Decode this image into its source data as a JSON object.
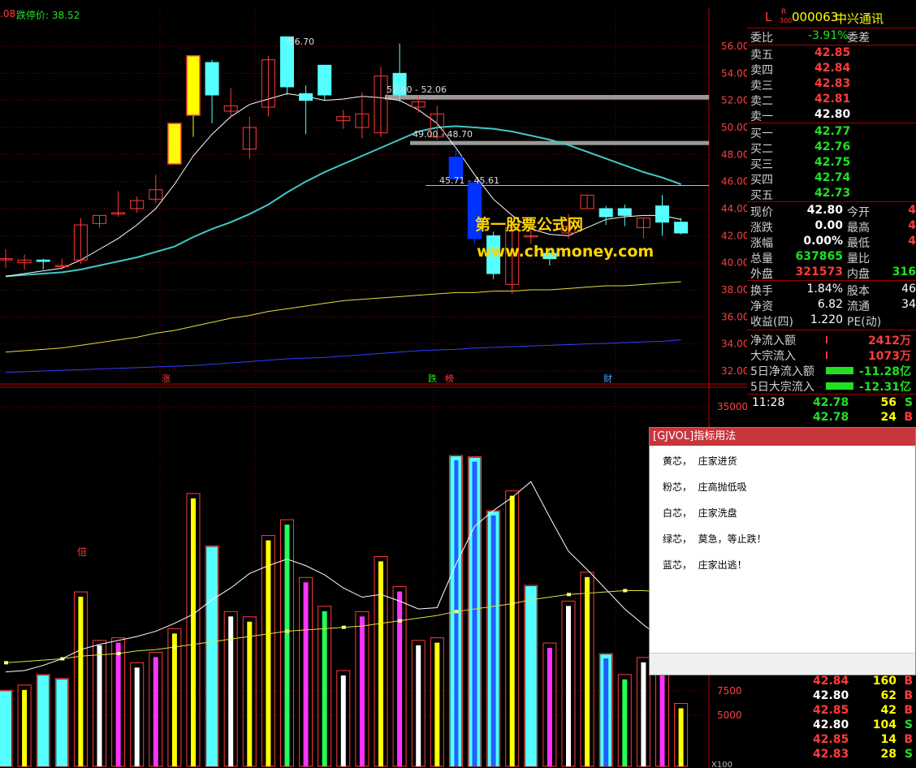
{
  "header": {
    "limit_down_label": "跌停价:",
    "limit_down_value": "38.52",
    "left_edge_value": ".08"
  },
  "stock": {
    "letter": "L",
    "badge_top": "R",
    "badge_bottom": "300",
    "code": "000063",
    "name": "中兴通讯"
  },
  "quote": {
    "webi_label": "委比",
    "webi_value": "-3.91%",
    "weicha_label": "委差",
    "asks": [
      {
        "label": "卖五",
        "price": "42.85"
      },
      {
        "label": "卖四",
        "price": "42.84"
      },
      {
        "label": "卖三",
        "price": "42.83"
      },
      {
        "label": "卖二",
        "price": "42.81"
      },
      {
        "label": "卖一",
        "price": "42.80"
      }
    ],
    "bids": [
      {
        "label": "买一",
        "price": "42.77"
      },
      {
        "label": "买二",
        "price": "42.76"
      },
      {
        "label": "买三",
        "price": "42.75"
      },
      {
        "label": "买四",
        "price": "42.74"
      },
      {
        "label": "买五",
        "price": "42.73"
      }
    ],
    "stats": [
      {
        "l1": "现价",
        "v1": "42.80",
        "l2": "今开",
        "v2": "4"
      },
      {
        "l1": "涨跌",
        "v1": "0.00",
        "l2": "最高",
        "v2": "4"
      },
      {
        "l1": "涨幅",
        "v1": "0.00%",
        "l2": "最低",
        "v2": "4"
      },
      {
        "l1": "总量",
        "v1": "637865",
        "l2": "量比",
        "v2": ""
      },
      {
        "l1": "外盘",
        "v1": "321573",
        "l2": "内盘",
        "v2": "316"
      }
    ],
    "stats2": [
      {
        "l1": "换手",
        "v1": "1.84%",
        "l2": "股本",
        "v2": "46"
      },
      {
        "l1": "净资",
        "v1": "6.82",
        "l2": "流通",
        "v2": "34"
      },
      {
        "l1": "收益(四)",
        "v1": "1.220",
        "l2": "PE(动)",
        "v2": ""
      }
    ],
    "flows": [
      {
        "label": "净流入额",
        "value": "2412万"
      },
      {
        "label": "大宗流入",
        "value": "1073万"
      },
      {
        "label": "5日净流入额",
        "value": "-11.28亿"
      },
      {
        "label": "5日大宗流入",
        "value": "-12.31亿"
      }
    ],
    "ticks_top": [
      {
        "time": "11:28",
        "price": "42.78",
        "vol": "56",
        "side": "S"
      },
      {
        "time": "",
        "price": "42.78",
        "vol": "24",
        "side": "B"
      }
    ],
    "ticks_bottom": [
      {
        "price": "42.84",
        "vol": "160",
        "side": "B"
      },
      {
        "price": "42.80",
        "vol": "62",
        "side": "B"
      },
      {
        "price": "42.85",
        "vol": "42",
        "side": "B"
      },
      {
        "price": "42.80",
        "vol": "104",
        "side": "S"
      },
      {
        "price": "42.85",
        "vol": "14",
        "side": "B"
      },
      {
        "price": "42.83",
        "vol": "28",
        "side": "S"
      }
    ]
  },
  "popup": {
    "title": "[GJVOL]指标用法",
    "lines": [
      "黄芯，  庄家进货",
      "粉芯，  庄高抛低吸",
      "白芯，  庄家洗盘",
      "绿芯，  莫急，等止跌！",
      "蓝芯，  庄家出逃！"
    ]
  },
  "watermark": {
    "line1": "第一股票公式网",
    "line2": "www.chnmoney.com"
  },
  "markers": {
    "rise": "涨",
    "fall": "跌",
    "list": "榜",
    "fin": "财",
    "bei": "倍"
  },
  "annotations": {
    "high": "56.70",
    "zone1": "52.40 - 52.06",
    "zone2": "49.00 - 48.70",
    "zone3": "45.71 - 45.61"
  },
  "vol_axis_unit": "X100",
  "colors": {
    "up": "#ff3b3b",
    "down_cyan": "#55ffff",
    "ma_cyan": "#40c8c8",
    "ma_yellow": "#e0e040",
    "ma_blue": "#3040ff",
    "grid_red": "#8b0000"
  },
  "chart_data": [
    {
      "type": "candlestick",
      "y_ticks": [
        "56.00",
        "54.00",
        "52.00",
        "50.00",
        "48.00",
        "46.00",
        "44.00",
        "42.00",
        "40.00",
        "38.00",
        "36.00",
        "34.00",
        "32.00"
      ],
      "ylim": [
        31.5,
        57.5
      ],
      "candles": [
        {
          "o": 40.3,
          "c": 40.3,
          "h": 41.0,
          "l": 39.6
        },
        {
          "o": 40.0,
          "c": 40.2,
          "h": 40.6,
          "l": 39.5
        },
        {
          "o": 40.2,
          "c": 40.1,
          "h": 40.3,
          "l": 39.5
        },
        {
          "o": 39.8,
          "c": 39.8,
          "h": 40.3,
          "l": 39.5
        },
        {
          "o": 40.2,
          "c": 42.8,
          "h": 43.3,
          "l": 39.9
        },
        {
          "o": 42.9,
          "c": 43.5,
          "h": 43.5,
          "l": 42.6
        },
        {
          "o": 43.6,
          "c": 43.7,
          "h": 45.3,
          "l": 43.4
        },
        {
          "o": 44.0,
          "c": 44.6,
          "h": 44.9,
          "l": 43.7
        },
        {
          "o": 44.7,
          "c": 45.4,
          "h": 46.5,
          "l": 44.4
        },
        {
          "o": 47.3,
          "c": 50.3,
          "h": 50.3,
          "l": 47.3
        },
        {
          "o": 50.9,
          "c": 55.3,
          "h": 55.3,
          "l": 49.3
        },
        {
          "o": 54.8,
          "c": 52.4,
          "h": 55.0,
          "l": 50.3
        },
        {
          "o": 51.2,
          "c": 51.6,
          "h": 52.9,
          "l": 50.7
        },
        {
          "o": 48.4,
          "c": 50.0,
          "h": 50.8,
          "l": 47.7
        },
        {
          "o": 51.5,
          "c": 55.0,
          "h": 55.3,
          "l": 50.8
        },
        {
          "o": 56.7,
          "c": 53.0,
          "h": 56.7,
          "l": 52.4
        },
        {
          "o": 52.5,
          "c": 52.0,
          "h": 53.1,
          "l": 49.5
        },
        {
          "o": 54.6,
          "c": 52.4,
          "h": 54.6,
          "l": 52.0
        },
        {
          "o": 50.5,
          "c": 50.8,
          "h": 51.3,
          "l": 49.9
        },
        {
          "o": 50.0,
          "c": 51.0,
          "h": 52.6,
          "l": 49.2
        },
        {
          "o": 49.6,
          "c": 53.8,
          "h": 54.5,
          "l": 49.3
        },
        {
          "o": 54.0,
          "c": 52.4,
          "h": 56.2,
          "l": 51.9
        },
        {
          "o": 51.5,
          "c": 51.9,
          "h": 52.4,
          "l": 51.1
        },
        {
          "o": 49.3,
          "c": 51.0,
          "h": 51.6,
          "l": 49.1
        },
        {
          "o": 47.8,
          "c": 46.2,
          "h": 48.4,
          "l": 46.2
        },
        {
          "o": 45.9,
          "c": 41.8,
          "h": 45.9,
          "l": 41.4
        },
        {
          "o": 42.0,
          "c": 39.2,
          "h": 42.3,
          "l": 38.8
        },
        {
          "o": 38.4,
          "c": 42.6,
          "h": 42.8,
          "l": 37.7
        },
        {
          "o": 42.0,
          "c": 42.0,
          "h": 42.4,
          "l": 41.4
        },
        {
          "o": 40.7,
          "c": 40.3,
          "h": 41.0,
          "l": 39.8
        },
        {
          "o": 42.2,
          "c": 42.7,
          "h": 43.6,
          "l": 41.8
        },
        {
          "o": 44.0,
          "c": 45.0,
          "h": 45.0,
          "l": 44.0
        },
        {
          "o": 44.0,
          "c": 43.4,
          "h": 44.2,
          "l": 42.8
        },
        {
          "o": 44.0,
          "c": 43.5,
          "h": 44.3,
          "l": 42.7
        },
        {
          "o": 42.6,
          "c": 43.3,
          "h": 43.3,
          "l": 41.8
        },
        {
          "o": 44.2,
          "c": 43.0,
          "h": 45.0,
          "l": 42.0
        },
        {
          "o": 43.0,
          "c": 42.2,
          "h": 43.3,
          "l": 42.1
        }
      ],
      "ma_white": [
        39.0,
        39.2,
        39.4,
        39.6,
        40.2,
        41.0,
        41.8,
        42.8,
        44.0,
        45.8,
        47.9,
        49.5,
        50.8,
        51.7,
        52.1,
        52.5,
        52.3,
        52.0,
        52.1,
        52.3,
        52.2,
        52.0,
        51.3,
        50.3,
        48.5,
        46.5,
        44.7,
        43.5,
        42.5,
        42.1,
        42.0,
        42.6,
        43.2,
        43.4,
        43.5,
        43.5,
        43.2
      ],
      "ma_cyan": [
        39.0,
        39.1,
        39.2,
        39.3,
        39.5,
        39.8,
        40.1,
        40.4,
        40.8,
        41.2,
        41.9,
        42.5,
        43.0,
        43.6,
        44.3,
        45.2,
        46.0,
        46.7,
        47.3,
        47.9,
        48.5,
        49.1,
        49.7,
        50.0,
        50.1,
        50.0,
        49.9,
        49.7,
        49.4,
        49.1,
        48.7,
        48.2,
        47.7,
        47.2,
        46.7,
        46.3,
        45.8
      ],
      "ma_yellow": [
        33.4,
        33.5,
        33.6,
        33.7,
        33.9,
        34.1,
        34.3,
        34.5,
        34.8,
        35.0,
        35.3,
        35.6,
        35.9,
        36.1,
        36.4,
        36.6,
        36.8,
        37.0,
        37.2,
        37.3,
        37.4,
        37.5,
        37.6,
        37.7,
        37.8,
        37.8,
        37.9,
        37.9,
        38.0,
        38.0,
        38.1,
        38.2,
        38.3,
        38.3,
        38.4,
        38.5,
        38.6
      ],
      "ma_blue": [
        31.9,
        31.95,
        32.0,
        32.05,
        32.1,
        32.15,
        32.2,
        32.25,
        32.3,
        32.35,
        32.4,
        32.5,
        32.6,
        32.7,
        32.8,
        32.9,
        32.95,
        33.0,
        33.1,
        33.2,
        33.3,
        33.4,
        33.5,
        33.55,
        33.6,
        33.7,
        33.75,
        33.8,
        33.85,
        33.9,
        33.95,
        34.0,
        34.05,
        34.1,
        34.15,
        34.2,
        34.3
      ],
      "zones": [
        [
          52.06,
          52.4
        ],
        [
          48.7,
          49.0
        ],
        [
          45.61,
          45.71
        ]
      ]
    },
    {
      "type": "bar",
      "y_ticks": [
        "35000",
        "7500",
        "5000"
      ],
      "bars": [
        {
          "v": 5800,
          "c": "cyan"
        },
        {
          "v": 6200,
          "c": "yellow"
        },
        {
          "v": 7000,
          "c": "cyan"
        },
        {
          "v": 6700,
          "c": "cyan"
        },
        {
          "v": 13300,
          "c": "yellow"
        },
        {
          "v": 9600,
          "c": "white"
        },
        {
          "v": 9800,
          "c": "magenta"
        },
        {
          "v": 7900,
          "c": "white"
        },
        {
          "v": 8700,
          "c": "magenta"
        },
        {
          "v": 10500,
          "c": "yellow"
        },
        {
          "v": 20800,
          "c": "yellow"
        },
        {
          "v": 16800,
          "c": "cyan"
        },
        {
          "v": 11800,
          "c": "white"
        },
        {
          "v": 11400,
          "c": "yellow"
        },
        {
          "v": 17600,
          "c": "yellow"
        },
        {
          "v": 18800,
          "c": "green"
        },
        {
          "v": 14400,
          "c": "magenta"
        },
        {
          "v": 12200,
          "c": "green"
        },
        {
          "v": 7300,
          "c": "white"
        },
        {
          "v": 11800,
          "c": "magenta"
        },
        {
          "v": 16000,
          "c": "yellow"
        },
        {
          "v": 13700,
          "c": "magenta"
        },
        {
          "v": 9600,
          "c": "white"
        },
        {
          "v": 9800,
          "c": "yellow"
        },
        {
          "v": 23700,
          "c": "cyan"
        },
        {
          "v": 23600,
          "c": "blue"
        },
        {
          "v": 19500,
          "c": "blue"
        },
        {
          "v": 21000,
          "c": "yellow"
        },
        {
          "v": 13800,
          "c": "cyan"
        },
        {
          "v": 9400,
          "c": "magenta"
        },
        {
          "v": 12600,
          "c": "white"
        },
        {
          "v": 14800,
          "c": "yellow"
        },
        {
          "v": 8600,
          "c": "blue"
        },
        {
          "v": 7000,
          "c": "green"
        },
        {
          "v": 8300,
          "c": "white"
        },
        {
          "v": 8900,
          "c": "magenta"
        },
        {
          "v": 4800,
          "c": "yellow"
        }
      ],
      "ma_white": [
        7200,
        7300,
        7700,
        8200,
        8900,
        9300,
        9600,
        9900,
        10300,
        10900,
        11600,
        12700,
        13600,
        14700,
        15300,
        15800,
        15300,
        14600,
        13600,
        12900,
        13100,
        12600,
        12000,
        12100,
        15400,
        18300,
        19500,
        20500,
        21700,
        19000,
        16400,
        15000,
        13500,
        12000,
        10800,
        9700,
        7400
      ],
      "ma_yellow": [
        7900,
        8000,
        8100,
        8200,
        8400,
        8500,
        8600,
        8800,
        8900,
        9100,
        9300,
        9500,
        9700,
        9900,
        10100,
        10300,
        10400,
        10500,
        10600,
        10700,
        10900,
        11100,
        11300,
        11500,
        11800,
        12000,
        12200,
        12400,
        12700,
        12900,
        13100,
        13200,
        13300,
        13400,
        13400,
        13300,
        13200
      ]
    }
  ]
}
